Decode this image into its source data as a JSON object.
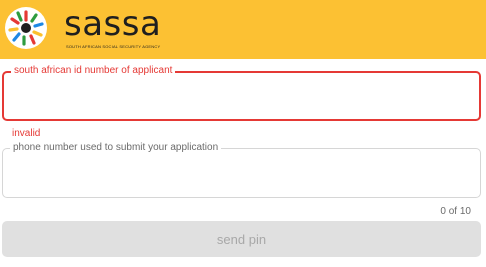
{
  "header": {
    "brand": "sassa",
    "subtitle": "SOUTH AFRICAN SOCIAL SECURITY AGENCY",
    "background_color": "#fcc133"
  },
  "form": {
    "id_field": {
      "label": "south african id number of applicant",
      "value": "",
      "error": "invalid",
      "border_color": "#e53935"
    },
    "phone_field": {
      "label": "phone number used to submit your application",
      "value": "",
      "counter": "0 of 10"
    },
    "submit": {
      "label": "send pin",
      "disabled": true
    }
  }
}
